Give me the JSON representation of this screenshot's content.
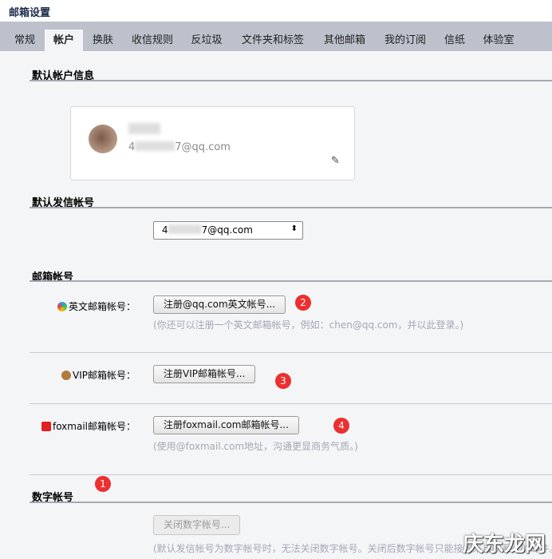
{
  "title": "邮箱设置",
  "tabs": [
    "常规",
    "帐户",
    "换肤",
    "收信规则",
    "反垃圾",
    "文件夹和标签",
    "其他邮箱",
    "我的订阅",
    "信纸",
    "体验室"
  ],
  "active_tab": "帐户",
  "sections": {
    "default_account": "默认帐户信息",
    "default_sender": "默认发信帐号",
    "mail_accounts": "邮箱帐号",
    "digital_account": "数字帐号"
  },
  "account": {
    "email_prefix": "4",
    "email_suffix": "7@qq.com"
  },
  "sender_select": {
    "prefix": "4",
    "suffix": "7@qq.com",
    "arrow": "⬍"
  },
  "rows": [
    {
      "label": "英文邮箱帐号：",
      "button": "注册@qq.com英文帐号...",
      "hint": "(你还可以注册一个英文邮箱帐号，例如：chen@qq.com，并以此登录。)",
      "badge": "2"
    },
    {
      "label": "VIP邮箱帐号：",
      "button": "注册VIP邮箱帐号...",
      "badge": "3"
    },
    {
      "label": "foxmail邮箱帐号：",
      "button": "注册foxmail.com邮箱帐号...",
      "hint": "(使用@foxmail.com地址，沟通更显商务气质。)",
      "badge": "4"
    }
  ],
  "digital": {
    "button": "关闭数字帐号...",
    "hint": "(默认发信帐号为数字帐号时，无法关闭数字帐号。关闭后数字帐号只能接收来自联系人的邮件。",
    "badge": "1"
  },
  "watermark": "庆东龙网"
}
